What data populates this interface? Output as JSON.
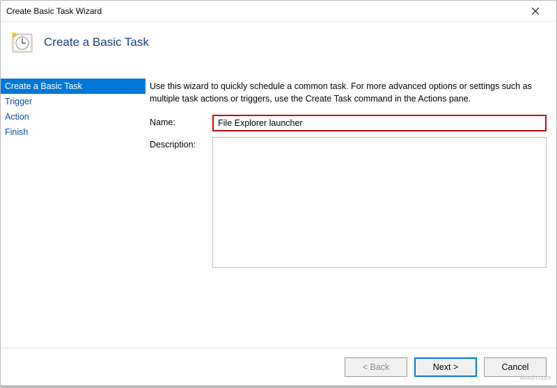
{
  "window": {
    "title": "Create Basic Task Wizard"
  },
  "header": {
    "title": "Create a Basic Task"
  },
  "sidebar": {
    "items": [
      {
        "label": "Create a Basic Task",
        "selected": true
      },
      {
        "label": "Trigger",
        "selected": false
      },
      {
        "label": "Action",
        "selected": false
      },
      {
        "label": "Finish",
        "selected": false
      }
    ]
  },
  "content": {
    "instructions": "Use this wizard to quickly schedule a common task.  For more advanced options or settings such as multiple task actions or triggers, use the Create Task command in the Actions pane.",
    "name_label": "Name:",
    "name_value": "File Explorer launcher",
    "description_label": "Description:",
    "description_value": ""
  },
  "footer": {
    "back_label": "< Back",
    "next_label": "Next >",
    "cancel_label": "Cancel"
  },
  "watermark": "wsxdn.com"
}
